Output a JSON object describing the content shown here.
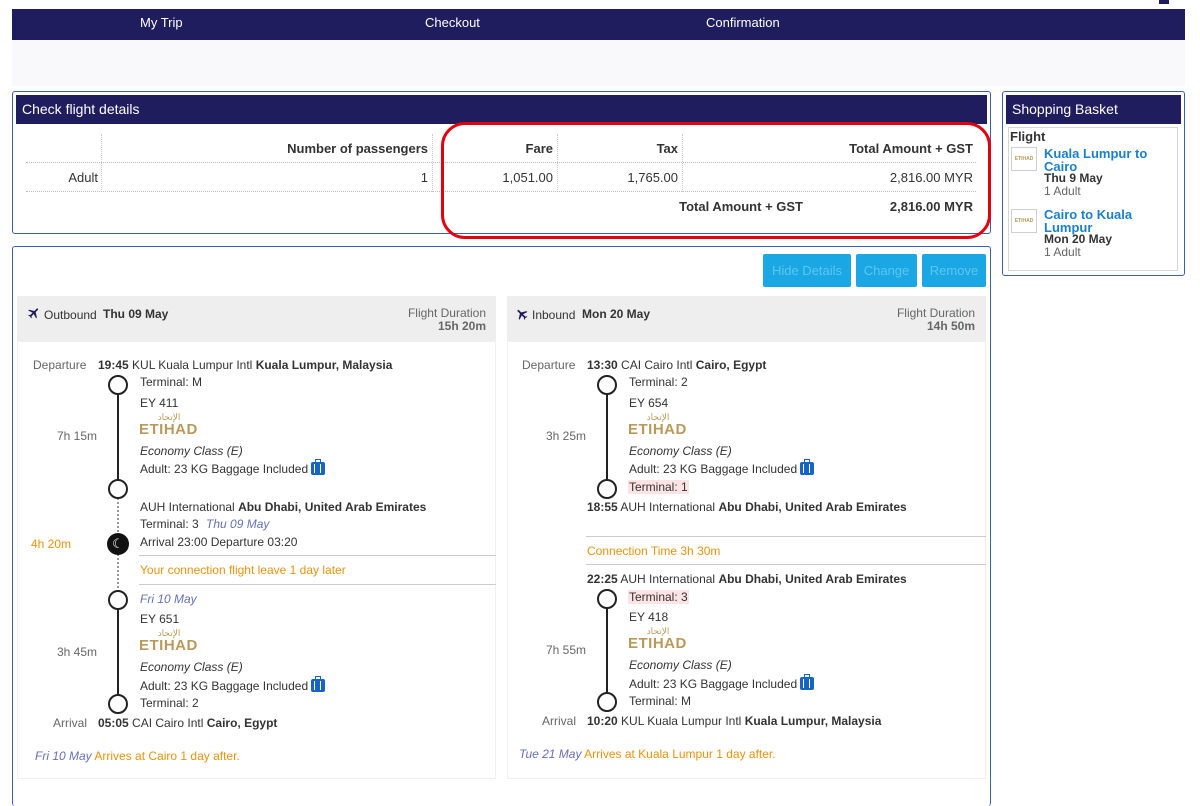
{
  "nav": {
    "items": [
      "My Trip",
      "Checkout",
      "Confirmation"
    ]
  },
  "check": {
    "title": "Check flight details",
    "headers": {
      "passengers": "Number of passengers",
      "fare": "Fare",
      "tax": "Tax",
      "total": "Total Amount + GST"
    },
    "row": {
      "type": "Adult",
      "count": "1",
      "fare": "1,051.00",
      "tax": "1,765.00",
      "total": "2,816.00 MYR"
    },
    "grand_label": "Total Amount + GST",
    "grand_value": "2,816.00 MYR"
  },
  "basket": {
    "title": "Shopping Basket",
    "section": "Flight",
    "items": [
      {
        "route": "Kuala Lumpur to Cairo",
        "date": "Thu 9 May",
        "pax": "1 Adult"
      },
      {
        "route": "Cairo to Kuala Lumpur",
        "date": "Mon 20 May",
        "pax": "1 Adult"
      }
    ]
  },
  "buttons": {
    "hide": "Hide Details",
    "change": "Change",
    "remove": "Remove"
  },
  "labels": {
    "departure": "Departure",
    "arrival": "Arrival",
    "flight_duration": "Flight Duration",
    "economy": "Economy Class (E)",
    "baggage": "Adult: 23 KG Baggage Included",
    "logo_ar": "الإتحاد",
    "logo_en": "ETIHAD"
  },
  "outbound": {
    "label": "Outbound",
    "date": "Thu 09 May",
    "duration": "15h 20m",
    "dep_time": "19:45",
    "dep_airport": "KUL Kuala Lumpur Intl",
    "dep_city": "Kuala Lumpur, Malaysia",
    "dep_terminal": "Terminal: M",
    "seg1_flight": "EY 411",
    "seg1_duration": "7h 15m",
    "conn_airport": "AUH International",
    "conn_city": "Abu Dhabi, United Arab Emirates",
    "conn_terminal": "Terminal: 3",
    "conn_date": "Thu 09 May",
    "conn_times": "Arrival 23:00 Departure 03:20",
    "layover": "4h 20m",
    "next_day_note": "Your connection flight leave 1 day later",
    "seg2_date": "Fri 10 May",
    "seg2_flight": "EY 651",
    "seg2_duration": "3h 45m",
    "arr_terminal": "Terminal: 2",
    "arr_time": "05:05",
    "arr_airport": "CAI Cairo Intl",
    "arr_city": "Cairo, Egypt",
    "foot_date": "Fri 10 May",
    "foot_note": "Arrives at Cairo 1 day after."
  },
  "inbound": {
    "label": "Inbound",
    "date": "Mon 20 May",
    "duration": "14h 50m",
    "dep_time": "13:30",
    "dep_airport": "CAI Cairo Intl",
    "dep_city": "Cairo, Egypt",
    "dep_terminal": "Terminal: 2",
    "seg1_flight": "EY 654",
    "seg1_duration": "3h 25m",
    "seg1_arr_terminal": "Terminal: 1",
    "conn_time": "18:55",
    "conn_airport": "AUH International",
    "conn_city": "Abu Dhabi, United Arab Emirates",
    "connection": "Connection Time 3h 30m",
    "seg2_time": "22:25",
    "seg2_airport": "AUH International",
    "seg2_city": "Abu Dhabi, United Arab Emirates",
    "seg2_terminal": "Terminal: 3",
    "seg2_flight": "EY 418",
    "seg2_duration": "7h 55m",
    "arr_terminal": "Terminal: M",
    "arr_time": "10:20",
    "arr_airport": "KUL Kuala Lumpur Intl",
    "arr_city": "Kuala Lumpur, Malaysia",
    "foot_date": "Tue 21 May",
    "foot_note": "Arrives at Kuala Lumpur 1 day after."
  }
}
